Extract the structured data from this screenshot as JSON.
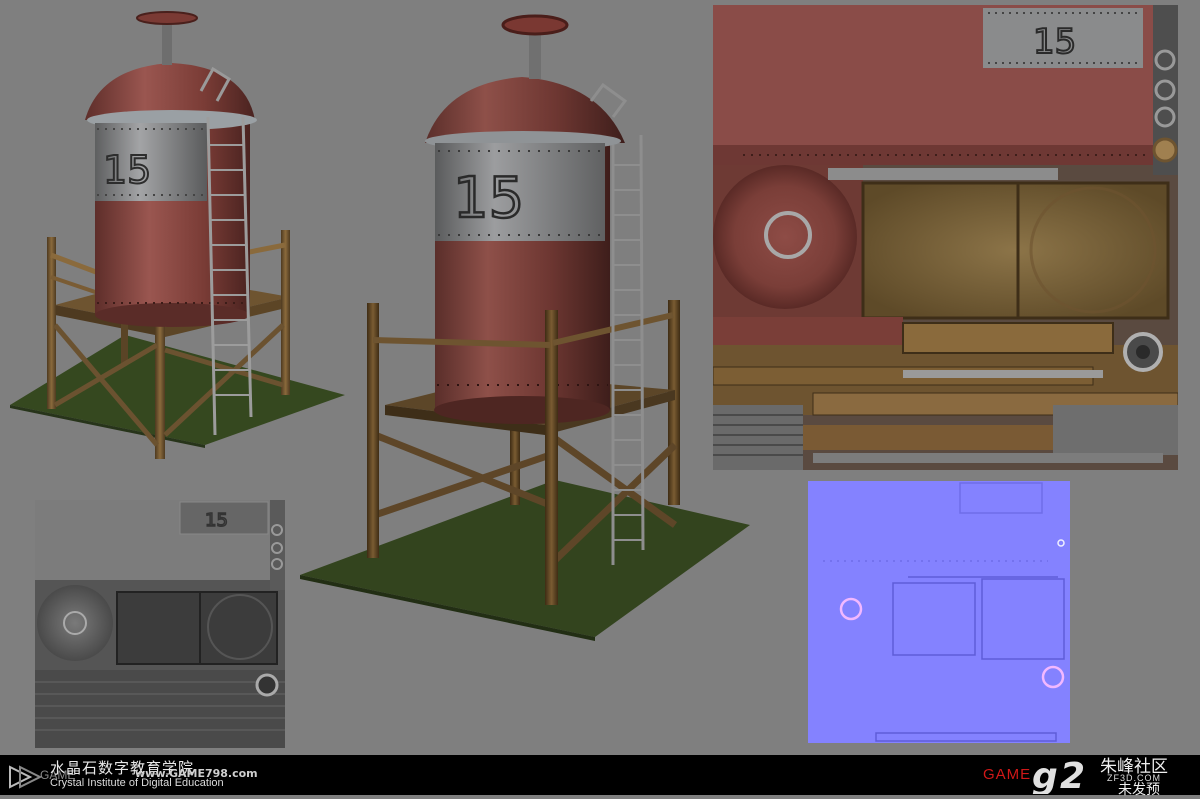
{
  "tank_number": "15",
  "watermark": {
    "chinese_name": "水晶石数字教育学院",
    "url": "www.GAME798.com",
    "english_name": "Crystal Institute of Digital Education",
    "left_logo_text": "GAME",
    "right_game": "GAME",
    "right_cn": "朱峰社区",
    "right_site": "ZF3D.COM",
    "right_cn_lower": "未发预"
  },
  "colors": {
    "background": "#7f7f7f",
    "rust_red": "#8a4a44",
    "metal_band": "#8e8f90",
    "wood": "#6e5530",
    "grass": "#3a4a2a",
    "normal_map": "#8482ff",
    "footer": "#000000",
    "brand_red": "#d01818"
  },
  "icons": [
    "valve-wheel-icon",
    "ladder-icon"
  ]
}
